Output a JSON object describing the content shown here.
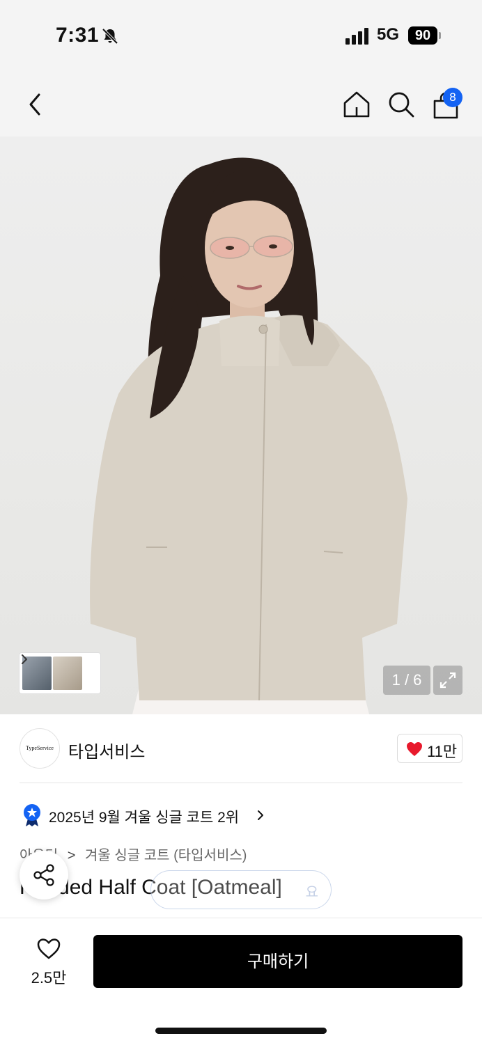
{
  "status_bar": {
    "time": "7:31",
    "network": "5G",
    "battery": "90"
  },
  "nav": {
    "cart_count": "8"
  },
  "gallery": {
    "counter": "1 / 6"
  },
  "brand": {
    "logo_text": "TypeService",
    "name": "타입서비스",
    "likes": "11만"
  },
  "ranking": {
    "text": "2025년 9월 겨울 싱글 코트 2위"
  },
  "breadcrumb": {
    "parent": "아우터",
    "separator": ">",
    "category": "겨울 싱글 코트 (타입서비스)"
  },
  "product": {
    "title": "Hooded Half Coat [Oatmeal]",
    "overlay_text": "요"
  },
  "bottom": {
    "wish_count": "2.5만",
    "buy_label": "구매하기"
  },
  "colors": {
    "accent": "#1463f3",
    "like": "#e8192c",
    "buy_button": "#000000"
  }
}
